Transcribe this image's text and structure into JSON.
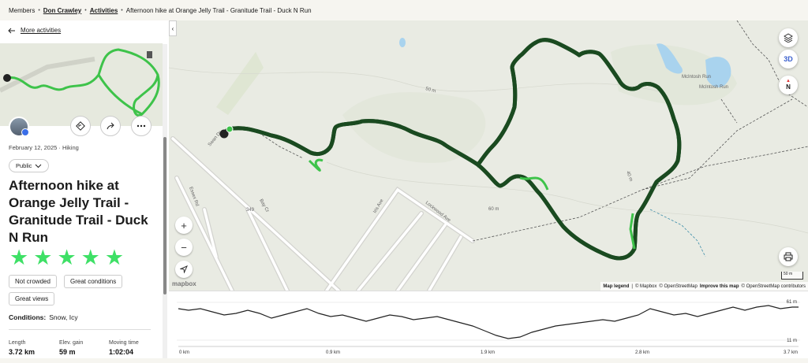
{
  "breadcrumb": {
    "members": "Members",
    "user": "Don Crawley",
    "activities": "Activities",
    "current": "Afternoon hike at Orange Jelly Trail - Granitude Trail - Duck N Run"
  },
  "sidebar": {
    "back_label": "More activities",
    "date_type": "February 12, 2025 · Hiking",
    "visibility": "Public",
    "title": "Afternoon hike at Orange Jelly Trail - Granitude Trail - Duck N Run",
    "rating": 5,
    "tags": [
      "Not crowded",
      "Great conditions",
      "Great views"
    ],
    "conditions_label": "Conditions:",
    "conditions_value": "Snow, Icy",
    "stats": [
      {
        "label": "Length",
        "value": "3.72 km"
      },
      {
        "label": "Elev. gain",
        "value": "59 m"
      },
      {
        "label": "Moving time",
        "value": "1:02:04"
      }
    ]
  },
  "map": {
    "labels": {
      "mcintosh_run": "McIntosh Run",
      "swan_dr": "Swan Dr",
      "bay_cr": "Bay Cr",
      "iris_ave": "Iris Ave",
      "lockwood_ave": "Lockwood Ave",
      "essex_rd": "Essex Rd",
      "route": "349",
      "c60": "60 m",
      "c50": "50 m",
      "c40": "40 m"
    },
    "mode_3d": "3D",
    "north": "N",
    "mapbox": "mapbox",
    "attribution": {
      "legend": "Map legend",
      "mapbox": "© Mapbox",
      "osm": "© OpenStreetMap",
      "improve": "Improve this map",
      "contributors": "© OpenStreetMap contributors"
    },
    "scale": "50 m",
    "colors": {
      "track": "#3ec34a",
      "water": "#a9d3ee"
    }
  },
  "elevation": {
    "x_ticks": [
      "0 km",
      "0.9 km",
      "1.9 km",
      "2.8 km",
      "3.7 km"
    ],
    "y_max": "61 m",
    "y_min": "11 m"
  }
}
